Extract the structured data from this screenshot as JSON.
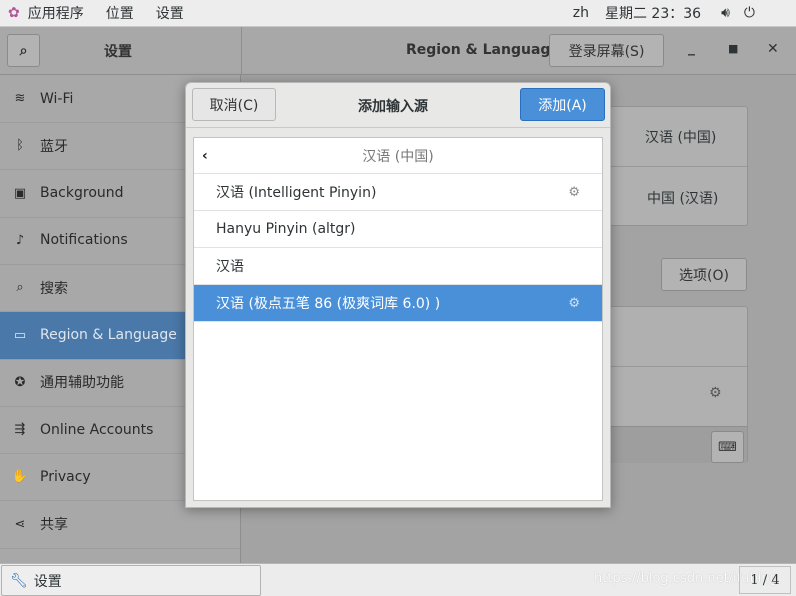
{
  "topbar": {
    "apps": "应用程序",
    "places": "位置",
    "settings": "设置",
    "lang": "zh",
    "clock": "星期二 23：36"
  },
  "header": {
    "sidebar_title": "设置",
    "panel_title": "Region & Language",
    "login_screen": "登录屏幕(S)"
  },
  "sidebar": {
    "items": [
      {
        "label": "Wi-Fi",
        "icon": "wifi-icon",
        "glyph": "≋"
      },
      {
        "label": "蓝牙",
        "icon": "bluetooth-icon",
        "glyph": "ᛒ"
      },
      {
        "label": "Background",
        "icon": "monitor-icon",
        "glyph": "▣"
      },
      {
        "label": "Notifications",
        "icon": "bell-icon",
        "glyph": "♪"
      },
      {
        "label": "搜索",
        "icon": "search-icon",
        "glyph": "⌕"
      },
      {
        "label": "Region & Language",
        "icon": "flag-icon",
        "glyph": "▭",
        "selected": true
      },
      {
        "label": "通用辅助功能",
        "icon": "accessibility-icon",
        "glyph": "✪"
      },
      {
        "label": "Online Accounts",
        "icon": "online-accounts-icon",
        "glyph": "⇶"
      },
      {
        "label": "Privacy",
        "icon": "hand-icon",
        "glyph": "✋"
      },
      {
        "label": "共享",
        "icon": "share-icon",
        "glyph": "⋖"
      }
    ]
  },
  "main": {
    "language": "汉语 (中国)",
    "formats": "中国 (汉语)",
    "options": "选项(O)"
  },
  "dialog": {
    "cancel": "取消(C)",
    "title": "添加输入源",
    "add": "添加(A)",
    "back_header": "汉语 (中国)",
    "rows": [
      {
        "label": "汉语 (Intelligent Pinyin)",
        "gear": true
      },
      {
        "label": "Hanyu Pinyin (altgr)",
        "gear": false
      },
      {
        "label": "汉语",
        "gear": false
      },
      {
        "label": "汉语 (极点五笔 86 (极爽词库 6.0) )",
        "gear": true,
        "selected": true
      }
    ]
  },
  "taskbar": {
    "app": "设置",
    "pager": "1 / 4",
    "watermark": "https://blog.csdn.net/ifubing"
  },
  "colors": {
    "accent": "#4a90d9",
    "selected_sidebar": "#4a78a8"
  }
}
